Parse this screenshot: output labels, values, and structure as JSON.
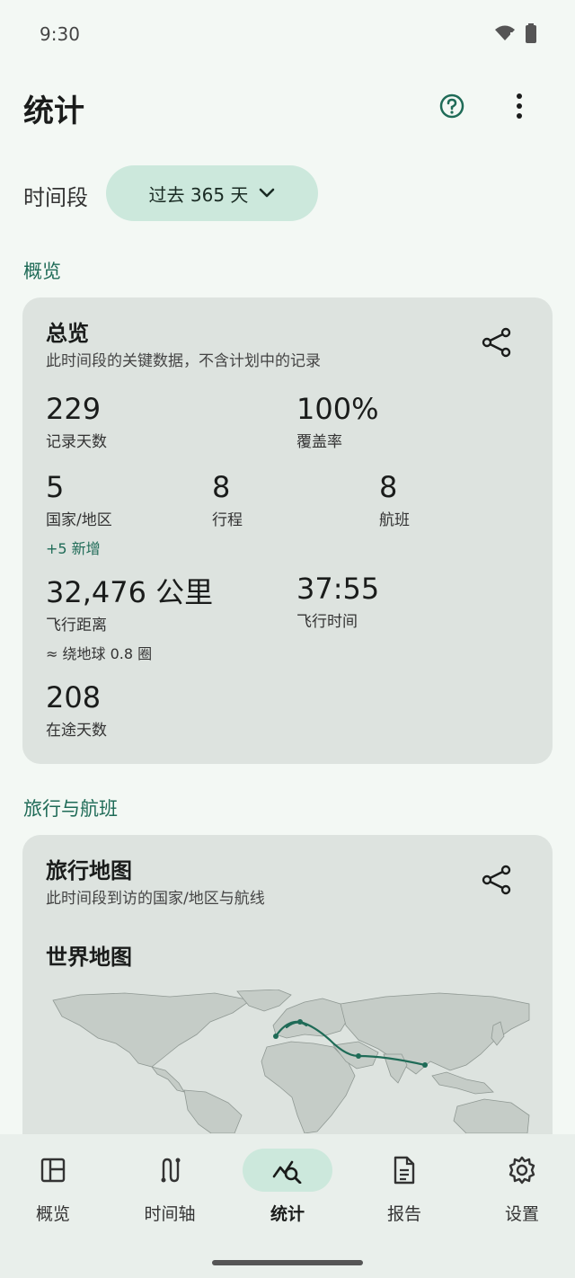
{
  "status": {
    "time": "9:30"
  },
  "header": {
    "title": "统计"
  },
  "period": {
    "label": "时间段",
    "selected": "过去 365 天"
  },
  "sections": {
    "overview": "概览",
    "travel": "旅行与航班"
  },
  "overview_card": {
    "title": "总览",
    "subtitle": "此时间段的关键数据，不含计划中的记录",
    "stats": {
      "record_days": {
        "value": "229",
        "label": "记录天数"
      },
      "coverage": {
        "value": "100%",
        "label": "覆盖率"
      },
      "countries": {
        "value": "5",
        "label": "国家/地区",
        "note": "+5 新增"
      },
      "trips": {
        "value": "8",
        "label": "行程"
      },
      "flights": {
        "value": "8",
        "label": "航班"
      },
      "flight_distance": {
        "value": "32,476 公里",
        "label": "飞行距离",
        "note": "≈ 绕地球 0.8 圈"
      },
      "flight_time": {
        "value": "37:55",
        "label": "飞行时间"
      },
      "travel_days": {
        "value": "208",
        "label": "在途天数"
      }
    }
  },
  "map_card": {
    "title": "旅行地图",
    "subtitle": "此时间段到访的国家/地区与航线",
    "map_title": "世界地图"
  },
  "nav": {
    "items": [
      {
        "label": "概览",
        "icon": "dashboard-icon"
      },
      {
        "label": "时间轴",
        "icon": "route-icon"
      },
      {
        "label": "统计",
        "icon": "analytics-icon"
      },
      {
        "label": "报告",
        "icon": "document-icon"
      },
      {
        "label": "设置",
        "icon": "gear-icon"
      }
    ]
  },
  "colors": {
    "accent": "#1f6b57",
    "chip": "#cce8dc",
    "card": "#dde3df",
    "background": "#f3f8f4"
  }
}
